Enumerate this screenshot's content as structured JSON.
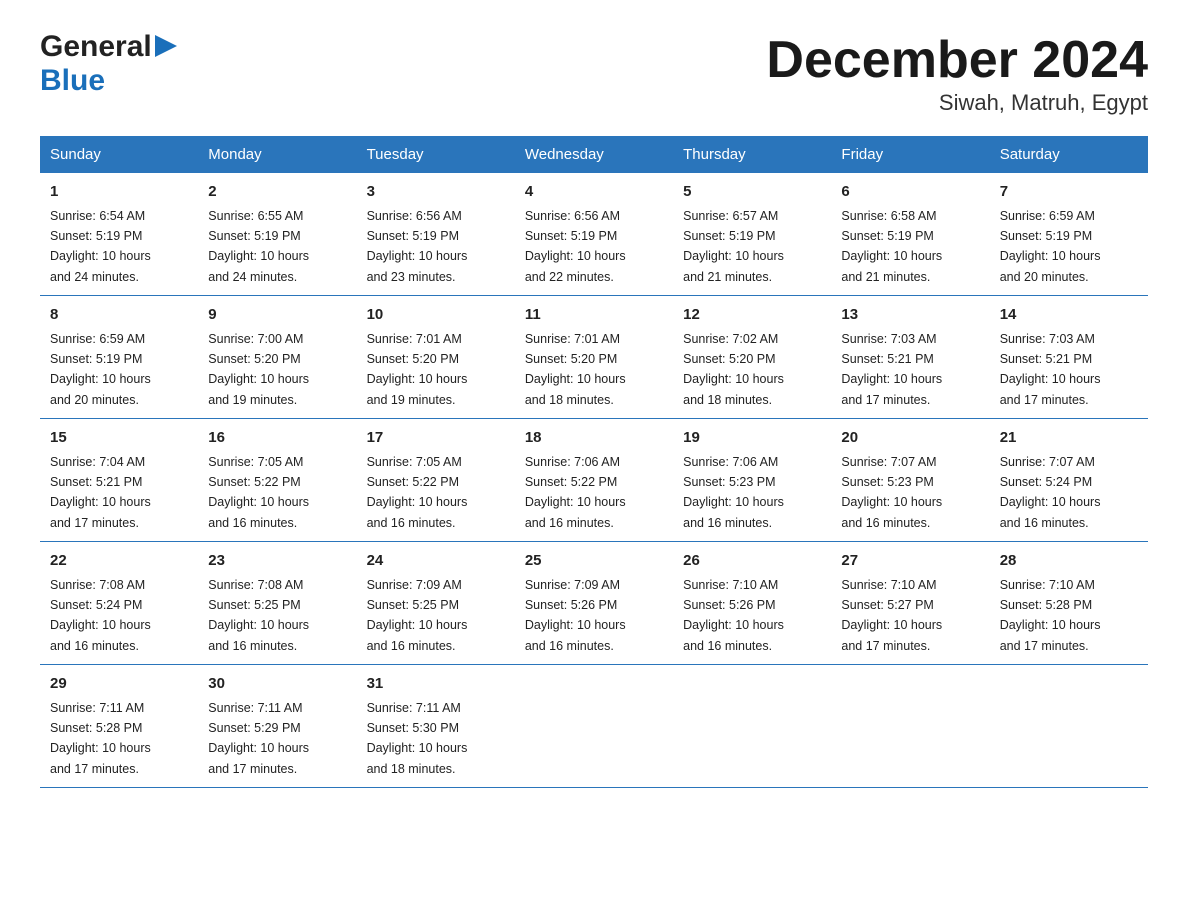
{
  "header": {
    "title": "December 2024",
    "subtitle": "Siwah, Matruh, Egypt",
    "logo_general": "General",
    "logo_blue": "Blue"
  },
  "days_of_week": [
    "Sunday",
    "Monday",
    "Tuesday",
    "Wednesday",
    "Thursday",
    "Friday",
    "Saturday"
  ],
  "weeks": [
    [
      {
        "day": "1",
        "sunrise": "6:54 AM",
        "sunset": "5:19 PM",
        "daylight": "10 hours and 24 minutes."
      },
      {
        "day": "2",
        "sunrise": "6:55 AM",
        "sunset": "5:19 PM",
        "daylight": "10 hours and 24 minutes."
      },
      {
        "day": "3",
        "sunrise": "6:56 AM",
        "sunset": "5:19 PM",
        "daylight": "10 hours and 23 minutes."
      },
      {
        "day": "4",
        "sunrise": "6:56 AM",
        "sunset": "5:19 PM",
        "daylight": "10 hours and 22 minutes."
      },
      {
        "day": "5",
        "sunrise": "6:57 AM",
        "sunset": "5:19 PM",
        "daylight": "10 hours and 21 minutes."
      },
      {
        "day": "6",
        "sunrise": "6:58 AM",
        "sunset": "5:19 PM",
        "daylight": "10 hours and 21 minutes."
      },
      {
        "day": "7",
        "sunrise": "6:59 AM",
        "sunset": "5:19 PM",
        "daylight": "10 hours and 20 minutes."
      }
    ],
    [
      {
        "day": "8",
        "sunrise": "6:59 AM",
        "sunset": "5:19 PM",
        "daylight": "10 hours and 20 minutes."
      },
      {
        "day": "9",
        "sunrise": "7:00 AM",
        "sunset": "5:20 PM",
        "daylight": "10 hours and 19 minutes."
      },
      {
        "day": "10",
        "sunrise": "7:01 AM",
        "sunset": "5:20 PM",
        "daylight": "10 hours and 19 minutes."
      },
      {
        "day": "11",
        "sunrise": "7:01 AM",
        "sunset": "5:20 PM",
        "daylight": "10 hours and 18 minutes."
      },
      {
        "day": "12",
        "sunrise": "7:02 AM",
        "sunset": "5:20 PM",
        "daylight": "10 hours and 18 minutes."
      },
      {
        "day": "13",
        "sunrise": "7:03 AM",
        "sunset": "5:21 PM",
        "daylight": "10 hours and 17 minutes."
      },
      {
        "day": "14",
        "sunrise": "7:03 AM",
        "sunset": "5:21 PM",
        "daylight": "10 hours and 17 minutes."
      }
    ],
    [
      {
        "day": "15",
        "sunrise": "7:04 AM",
        "sunset": "5:21 PM",
        "daylight": "10 hours and 17 minutes."
      },
      {
        "day": "16",
        "sunrise": "7:05 AM",
        "sunset": "5:22 PM",
        "daylight": "10 hours and 16 minutes."
      },
      {
        "day": "17",
        "sunrise": "7:05 AM",
        "sunset": "5:22 PM",
        "daylight": "10 hours and 16 minutes."
      },
      {
        "day": "18",
        "sunrise": "7:06 AM",
        "sunset": "5:22 PM",
        "daylight": "10 hours and 16 minutes."
      },
      {
        "day": "19",
        "sunrise": "7:06 AM",
        "sunset": "5:23 PM",
        "daylight": "10 hours and 16 minutes."
      },
      {
        "day": "20",
        "sunrise": "7:07 AM",
        "sunset": "5:23 PM",
        "daylight": "10 hours and 16 minutes."
      },
      {
        "day": "21",
        "sunrise": "7:07 AM",
        "sunset": "5:24 PM",
        "daylight": "10 hours and 16 minutes."
      }
    ],
    [
      {
        "day": "22",
        "sunrise": "7:08 AM",
        "sunset": "5:24 PM",
        "daylight": "10 hours and 16 minutes."
      },
      {
        "day": "23",
        "sunrise": "7:08 AM",
        "sunset": "5:25 PM",
        "daylight": "10 hours and 16 minutes."
      },
      {
        "day": "24",
        "sunrise": "7:09 AM",
        "sunset": "5:25 PM",
        "daylight": "10 hours and 16 minutes."
      },
      {
        "day": "25",
        "sunrise": "7:09 AM",
        "sunset": "5:26 PM",
        "daylight": "10 hours and 16 minutes."
      },
      {
        "day": "26",
        "sunrise": "7:10 AM",
        "sunset": "5:26 PM",
        "daylight": "10 hours and 16 minutes."
      },
      {
        "day": "27",
        "sunrise": "7:10 AM",
        "sunset": "5:27 PM",
        "daylight": "10 hours and 17 minutes."
      },
      {
        "day": "28",
        "sunrise": "7:10 AM",
        "sunset": "5:28 PM",
        "daylight": "10 hours and 17 minutes."
      }
    ],
    [
      {
        "day": "29",
        "sunrise": "7:11 AM",
        "sunset": "5:28 PM",
        "daylight": "10 hours and 17 minutes."
      },
      {
        "day": "30",
        "sunrise": "7:11 AM",
        "sunset": "5:29 PM",
        "daylight": "10 hours and 17 minutes."
      },
      {
        "day": "31",
        "sunrise": "7:11 AM",
        "sunset": "5:30 PM",
        "daylight": "10 hours and 18 minutes."
      },
      null,
      null,
      null,
      null
    ]
  ],
  "labels": {
    "sunrise": "Sunrise:",
    "sunset": "Sunset:",
    "daylight": "Daylight:"
  }
}
